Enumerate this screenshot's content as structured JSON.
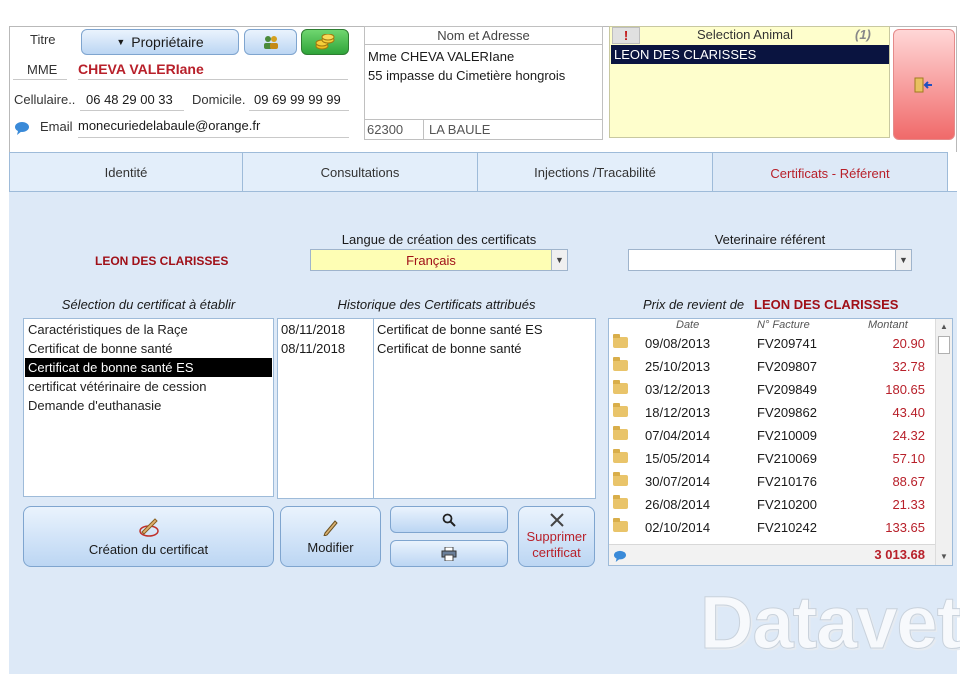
{
  "owner": {
    "titre_label": "Titre",
    "role_button": "Propriétaire",
    "civilite": "MME",
    "name": "CHEVA VALERIane",
    "cell_label": "Cellulaire..",
    "cell_value": "06 48 29 00 33",
    "dom_label": "Domicile.",
    "dom_value": "09 69 99 99 99",
    "email_label": "Email",
    "email_value": "monecuriedelabaule@orange.fr"
  },
  "address": {
    "header": "Nom et Adresse",
    "line1": "Mme CHEVA VALERIane",
    "line2": "55 impasse du Cimetière hongrois",
    "zip": "62300",
    "city": "LA BAULE"
  },
  "animal_select": {
    "warn": "!",
    "header": "Selection Animal",
    "count": "(1)",
    "selected": "LEON DES CLARISSES"
  },
  "tabs": [
    "Identité",
    "Consultations",
    "Injections /Tracabilité",
    "Certificats - Référent"
  ],
  "certs": {
    "animal_name": "LEON DES CLARISSES",
    "langue_label": "Langue de création des certificats",
    "langue_value": "Français",
    "vet_label": "Veterinaire référent",
    "vet_value": "",
    "selection_label": "Sélection du certificat à établir",
    "selection_items": [
      "Caractéristiques de la Raçe",
      "Certificat de bonne santé",
      "Certificat de bonne santé  ES",
      "certificat vétérinaire de cession",
      "Demande d'euthanasie"
    ],
    "history_label": "Historique des Certificats attribués",
    "history": [
      {
        "date": "08/11/2018",
        "name": "Certificat de bonne santé  ES"
      },
      {
        "date": "08/11/2018",
        "name": "Certificat de bonne santé"
      }
    ],
    "btn_create": "Création du certificat",
    "btn_modify": "Modifier",
    "btn_delete": "Supprimer certificat"
  },
  "prix": {
    "label": "Prix de revient de",
    "animal": "LEON DES CLARISSES",
    "col_date": "Date",
    "col_facture": "N° Facture",
    "col_montant": "Montant",
    "rows": [
      {
        "date": "09/08/2013",
        "facture": "FV209741",
        "montant": "20.90"
      },
      {
        "date": "25/10/2013",
        "facture": "FV209807",
        "montant": "32.78"
      },
      {
        "date": "03/12/2013",
        "facture": "FV209849",
        "montant": "180.65"
      },
      {
        "date": "18/12/2013",
        "facture": "FV209862",
        "montant": "43.40"
      },
      {
        "date": "07/04/2014",
        "facture": "FV210009",
        "montant": "24.32"
      },
      {
        "date": "15/05/2014",
        "facture": "FV210069",
        "montant": "57.10"
      },
      {
        "date": "30/07/2014",
        "facture": "FV210176",
        "montant": "88.67"
      },
      {
        "date": "26/08/2014",
        "facture": "FV210200",
        "montant": "21.33"
      },
      {
        "date": "02/10/2014",
        "facture": "FV210242",
        "montant": "133.65"
      }
    ],
    "total": "3 013.68"
  },
  "watermark": "Datavet"
}
